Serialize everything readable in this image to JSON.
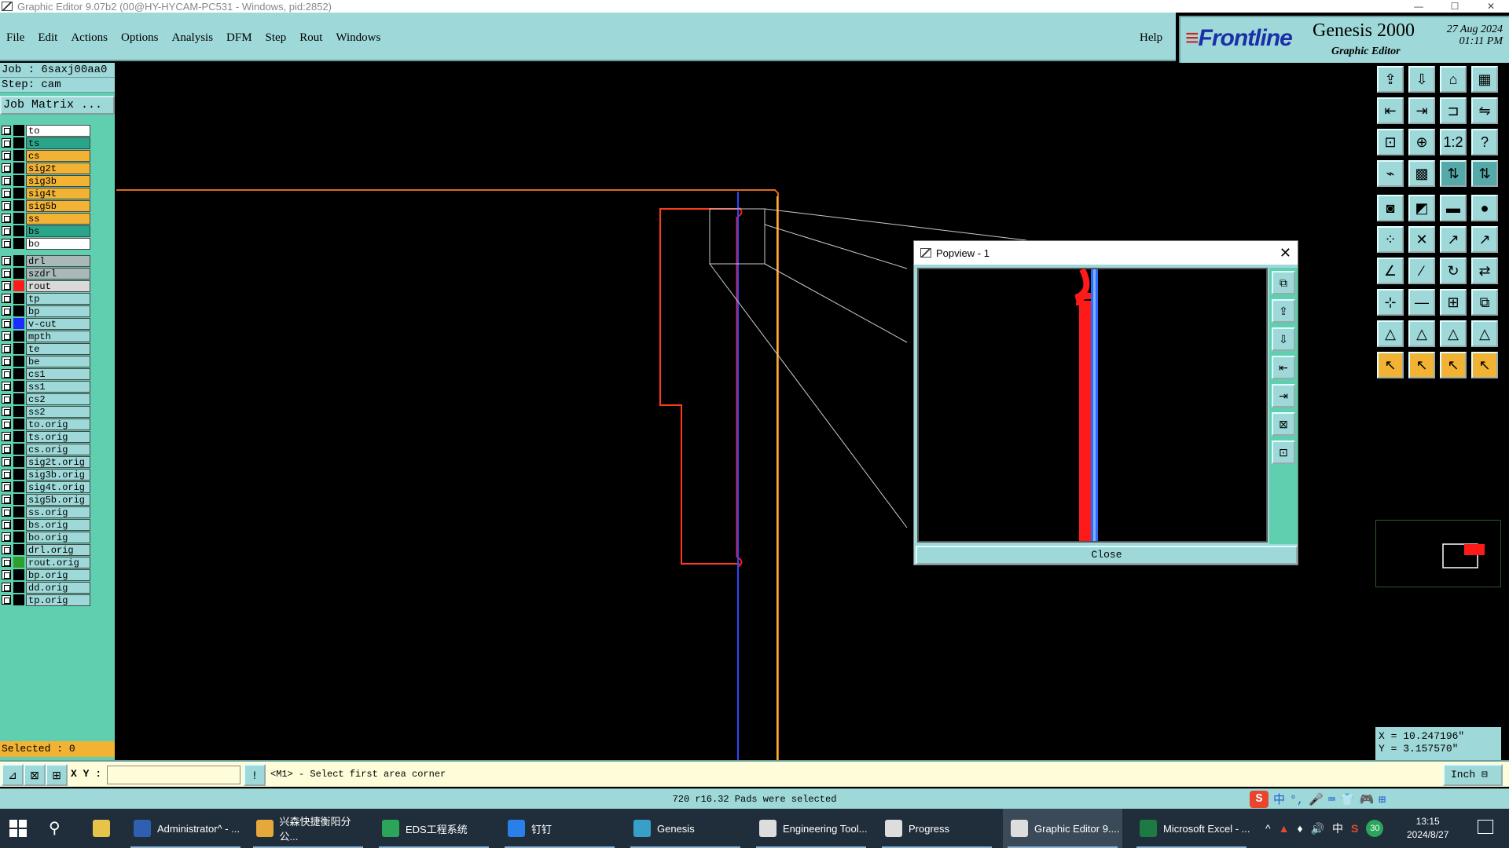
{
  "window": {
    "title": "Graphic Editor 9.07b2 (00@HY-HYCAM-PC531 - Windows, pid:2852)",
    "controls": [
      "—",
      "☐",
      "✕"
    ]
  },
  "menu": {
    "items": [
      "File",
      "Edit",
      "Actions",
      "Options",
      "Analysis",
      "DFM",
      "Step",
      "Rout",
      "Windows"
    ],
    "help": "Help"
  },
  "brand": {
    "logo": "Frontline",
    "product": "Genesis 2000",
    "subtitle": "Graphic Editor",
    "date": "27 Aug 2024",
    "time": "01:11 PM"
  },
  "job": {
    "job_line": "Job : 6saxj00aa0",
    "step_line": "Step: cam",
    "matrix_button": "Job Matrix ..."
  },
  "layers_group1": [
    {
      "name": "to",
      "color": "#ffffff",
      "swatch": "#000000"
    },
    {
      "name": "ts",
      "color": "#2aa58a",
      "swatch": "#000000"
    },
    {
      "name": "cs",
      "color": "#f2b233",
      "swatch": "#000000"
    },
    {
      "name": "sig2t",
      "color": "#f2b233",
      "swatch": "#000000"
    },
    {
      "name": "sig3b",
      "color": "#f2b233",
      "swatch": "#000000"
    },
    {
      "name": "sig4t",
      "color": "#f2b233",
      "swatch": "#000000"
    },
    {
      "name": "sig5b",
      "color": "#f2b233",
      "swatch": "#000000"
    },
    {
      "name": "ss",
      "color": "#f2b233",
      "swatch": "#000000"
    },
    {
      "name": "bs",
      "color": "#2aa58a",
      "swatch": "#000000"
    },
    {
      "name": "bo",
      "color": "#ffffff",
      "swatch": "#000000"
    }
  ],
  "layers_group2": [
    {
      "name": "drl",
      "color": "#a9b8b8",
      "swatch": "#000000"
    },
    {
      "name": "szdrl",
      "color": "#a9b8b8",
      "swatch": "#000000"
    },
    {
      "name": "rout",
      "color": "#d9d9d9",
      "swatch": "#ff1a1a"
    }
  ],
  "layers_group3": [
    {
      "name": "tp",
      "color": "#9ed8d8",
      "swatch": "#000000"
    },
    {
      "name": "bp",
      "color": "#9ed8d8",
      "swatch": "#000000"
    },
    {
      "name": "v-cut",
      "color": "#9ed8d8",
      "swatch": "#1a2cff"
    },
    {
      "name": "mpth",
      "color": "#9ed8d8",
      "swatch": "#000000"
    },
    {
      "name": "te",
      "color": "#9ed8d8",
      "swatch": "#000000"
    },
    {
      "name": "be",
      "color": "#9ed8d8",
      "swatch": "#000000"
    },
    {
      "name": "cs1",
      "color": "#9ed8d8",
      "swatch": "#000000"
    },
    {
      "name": "ss1",
      "color": "#9ed8d8",
      "swatch": "#000000"
    },
    {
      "name": "cs2",
      "color": "#9ed8d8",
      "swatch": "#000000"
    },
    {
      "name": "ss2",
      "color": "#9ed8d8",
      "swatch": "#000000"
    },
    {
      "name": "to.orig",
      "color": "#9ed8d8",
      "swatch": "#000000"
    },
    {
      "name": "ts.orig",
      "color": "#9ed8d8",
      "swatch": "#000000"
    },
    {
      "name": "cs.orig",
      "color": "#9ed8d8",
      "swatch": "#000000"
    },
    {
      "name": "sig2t.orig",
      "color": "#9ed8d8",
      "swatch": "#000000"
    },
    {
      "name": "sig3b.orig",
      "color": "#9ed8d8",
      "swatch": "#000000"
    },
    {
      "name": "sig4t.orig",
      "color": "#9ed8d8",
      "swatch": "#000000"
    },
    {
      "name": "sig5b.orig",
      "color": "#9ed8d8",
      "swatch": "#000000"
    },
    {
      "name": "ss.orig",
      "color": "#9ed8d8",
      "swatch": "#000000"
    },
    {
      "name": "bs.orig",
      "color": "#9ed8d8",
      "swatch": "#000000"
    },
    {
      "name": "bo.orig",
      "color": "#9ed8d8",
      "swatch": "#000000"
    },
    {
      "name": "drl.orig",
      "color": "#9ed8d8",
      "swatch": "#000000"
    },
    {
      "name": "rout.orig",
      "color": "#9ed8d8",
      "swatch": "#2e9e2e"
    },
    {
      "name": "bp.orig",
      "color": "#9ed8d8",
      "swatch": "#000000"
    },
    {
      "name": "dd.orig",
      "color": "#9ed8d8",
      "swatch": "#000000"
    },
    {
      "name": "tp.orig",
      "color": "#9ed8d8",
      "swatch": "#000000"
    }
  ],
  "selected_text": "Selected : 0",
  "popview": {
    "title": "Popview - 1",
    "close_button": "Close",
    "close_icon": "✕",
    "tools": [
      "zoom-icon",
      "pan-icon",
      "fit-icon",
      "prev-icon",
      "next-icon",
      "home-icon",
      "refresh-icon"
    ]
  },
  "right_tools": [
    "layers-up-icon",
    "layers-down-icon",
    "home-icon",
    "grid-icon",
    "arrow-left-icon",
    "arrow-right-icon",
    "zoom-out-icon",
    "swap-icon",
    "fit-all-icon",
    "center-icon",
    "scale-icon",
    "help-icon",
    "snap-icon",
    "mesh-icon",
    "route-icon",
    "route2-icon",
    "pad-icon",
    "line-icon",
    "measure-icon",
    "dot-icon",
    "node-icon",
    "cross-icon",
    "split-icon",
    "join-icon",
    "angle-icon",
    "slant-icon",
    "arc-icon",
    "flip-icon",
    "move-icon",
    "trim-icon",
    "align-icon",
    "group-icon",
    "tri1-icon",
    "tri2-icon",
    "tri3-icon",
    "tri4-icon",
    "pointer1-icon",
    "pointer2-icon",
    "pointer3-icon",
    "pointer4-icon"
  ],
  "coords": {
    "x": "X = 10.247196\"",
    "y": "Y = 3.157570\""
  },
  "cmdbar": {
    "xy_label": "X Y :",
    "input_value": "",
    "message": "<M1> - Select first area corner",
    "unit": "Inch ⊟"
  },
  "status": {
    "message": "720 r16.32 Pads were selected",
    "ime": [
      "中",
      "°,",
      "🎤",
      "⌨",
      "👕",
      "🎮",
      "⊞"
    ]
  },
  "taskbar": {
    "items": [
      {
        "label": "Administrator^ - ...",
        "color": "#2f5fb0"
      },
      {
        "label": "兴森快捷衡阳分公...",
        "color": "#e6a83a"
      },
      {
        "label": "EDS工程系统",
        "color": "#2aa55a"
      },
      {
        "label": "钉钉",
        "color": "#2a7fe8"
      },
      {
        "label": "Genesis",
        "color": "#38a0c8"
      },
      {
        "label": "Engineering Tool...",
        "color": "#dddddd"
      },
      {
        "label": "Progress",
        "color": "#dddddd"
      },
      {
        "label": "Graphic Editor 9....",
        "color": "#dddddd"
      },
      {
        "label": "Microsoft Excel - ...",
        "color": "#1e7a43"
      }
    ],
    "tray": [
      "^",
      "▲",
      "♦",
      "🔊",
      "中",
      "S",
      "30"
    ],
    "time": "13:15",
    "date": "2024/8/27"
  }
}
